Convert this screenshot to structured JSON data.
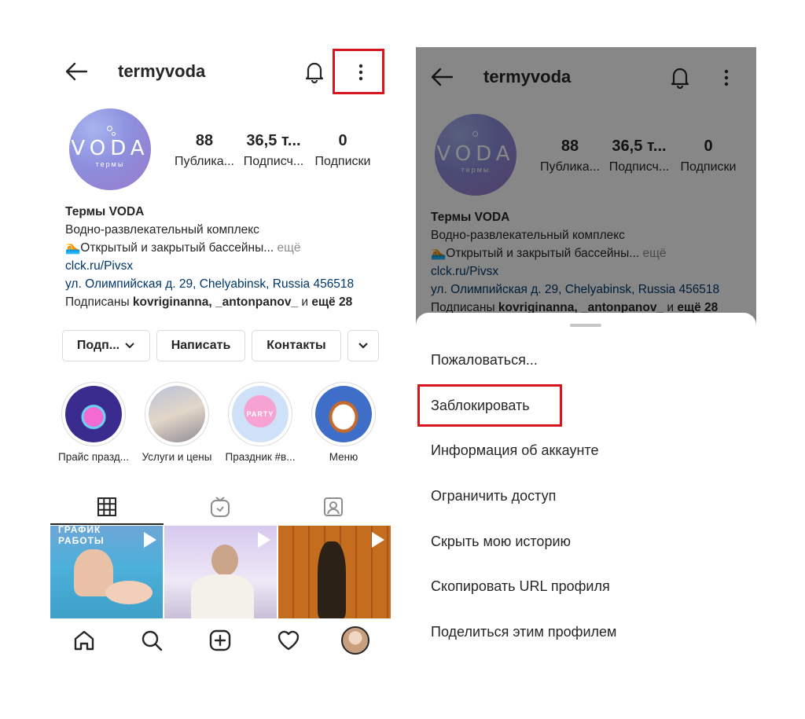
{
  "profile": {
    "username": "termyvoda",
    "logo_text": "VODA",
    "logo_sub": "термы",
    "stats": [
      {
        "value": "88",
        "label": "Публика..."
      },
      {
        "value": "36,5 т...",
        "label": "Подписч..."
      },
      {
        "value": "0",
        "label": "Подписки"
      }
    ],
    "name": "Термы VODA",
    "bio_line1": "Водно-развлекательный комплекс",
    "bio_line2": "🏊Открытый и закрытый бассейны...",
    "bio_more": " ещё",
    "link": "clck.ru/Pivsx",
    "address": "ул. Олимпийская д. 29, Chelyabinsk, Russia 456518",
    "followed_prefix": "Подписаны ",
    "followed_names": "kovriginanna, _antonpanov_",
    "followed_mid": " и ",
    "followed_more": "ещё 28"
  },
  "buttons": {
    "follow": "Подп...",
    "message": "Написать",
    "contacts": "Контакты"
  },
  "highlights": [
    {
      "label": "Прайс празд..."
    },
    {
      "label": "Услуги и цены"
    },
    {
      "label": "Праздник #в..."
    },
    {
      "label": "Меню"
    }
  ],
  "party_text": "PARTY",
  "grid_overlay_text": {
    "line1": "ГРАФИК",
    "line2": "РАБОТЫ"
  },
  "menu": {
    "items": [
      "Пожаловаться...",
      "Заблокировать",
      "Информация об аккаунте",
      "Ограничить доступ",
      "Скрыть мою историю",
      "Скопировать URL профиля",
      "Поделиться этим профилем"
    ]
  },
  "colors": {
    "highlight_box": "#d8141c",
    "link": "#00376b",
    "overlay": "rgba(0,0,0,0.47)"
  },
  "icons": [
    "back-arrow-icon",
    "bell-icon",
    "more-dots-icon",
    "grid-icon",
    "igtv-icon",
    "tagged-icon",
    "home-icon",
    "search-icon",
    "add-post-icon",
    "heart-icon",
    "chevron-down-icon"
  ]
}
